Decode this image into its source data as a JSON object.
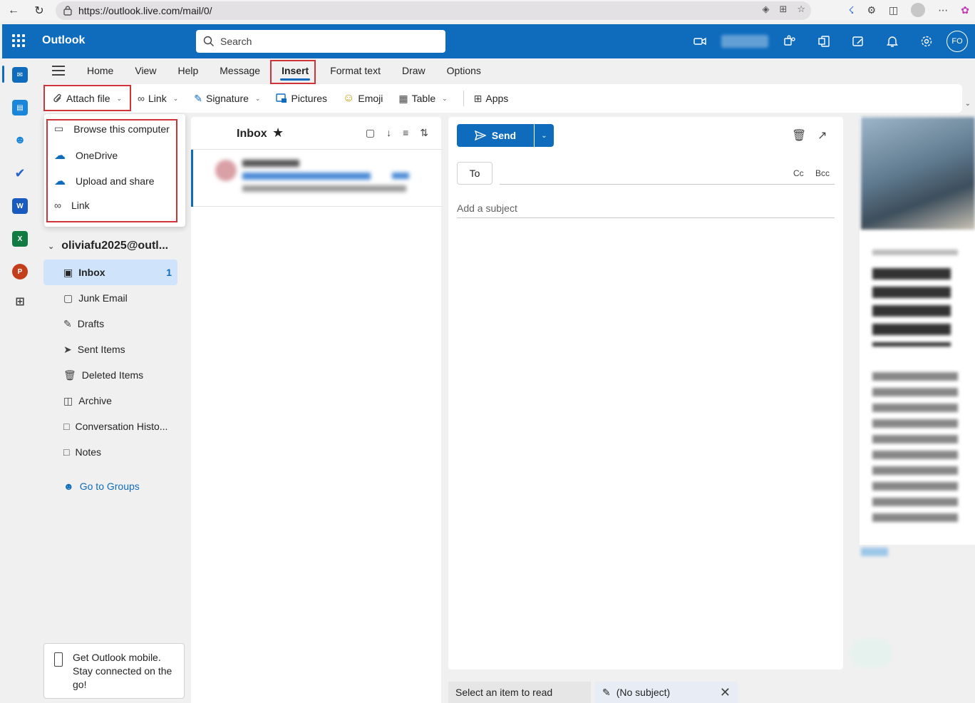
{
  "browser": {
    "url": "https://outlook.live.com/mail/0/"
  },
  "header": {
    "app_name": "Outlook",
    "search_placeholder": "Search",
    "avatar_initials": "FO"
  },
  "ribbon": {
    "tabs": [
      "Home",
      "View",
      "Help",
      "Message",
      "Insert",
      "Format text",
      "Draw",
      "Options"
    ],
    "active_tab": "Insert",
    "commands": {
      "attach_file": "Attach file",
      "link": "Link",
      "signature": "Signature",
      "pictures": "Pictures",
      "emoji": "Emoji",
      "table": "Table",
      "apps": "Apps"
    }
  },
  "attach_menu": {
    "items": [
      "Browse this computer",
      "OneDrive",
      "Upload and share",
      "Link"
    ]
  },
  "folders": {
    "account": "oliviafu2025@outl...",
    "items": [
      {
        "label": "Inbox",
        "count": "1"
      },
      {
        "label": "Junk Email"
      },
      {
        "label": "Drafts"
      },
      {
        "label": "Sent Items"
      },
      {
        "label": "Deleted Items"
      },
      {
        "label": "Archive"
      },
      {
        "label": "Conversation Histo..."
      },
      {
        "label": "Notes"
      }
    ],
    "groups_link": "Go to Groups",
    "mobile_promo": "Get Outlook mobile. Stay connected on the go!"
  },
  "message_list": {
    "title": "Inbox"
  },
  "compose": {
    "send_label": "Send",
    "to_label": "To",
    "cc_label": "Cc",
    "bcc_label": "Bcc",
    "subject_placeholder": "Add a subject"
  },
  "status_bar": {
    "reading_hint": "Select an item to read",
    "draft_tab": "(No subject)"
  },
  "colors": {
    "brand": "#0f6cbd",
    "highlight_box": "#d13438",
    "selected_folder": "#cfe4fa"
  }
}
